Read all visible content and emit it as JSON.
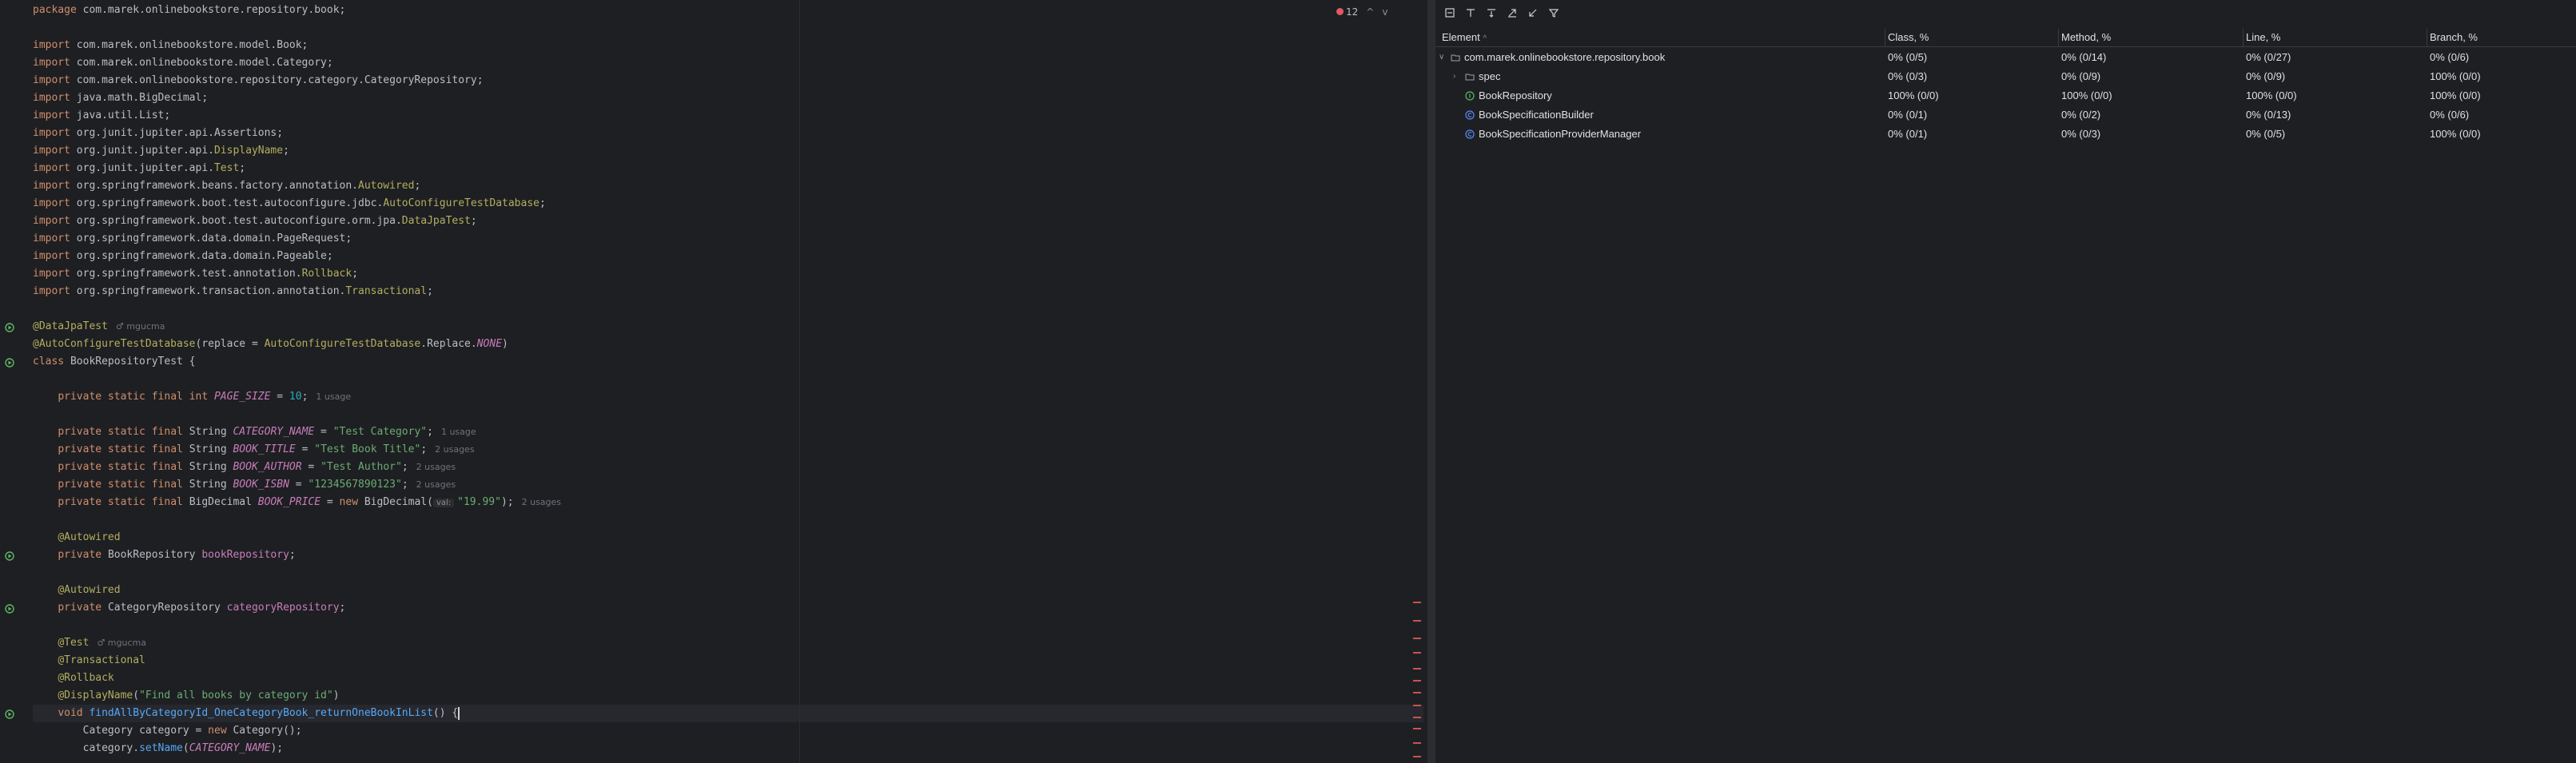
{
  "editor": {
    "lines": [
      [
        [
          "kw",
          "package "
        ],
        [
          "t",
          "com.marek.onlinebookstore.repository.book;"
        ]
      ],
      [],
      [
        [
          "kw",
          "import "
        ],
        [
          "t",
          "com.marek.onlinebookstore.model.Book;"
        ]
      ],
      [
        [
          "kw",
          "import "
        ],
        [
          "t",
          "com.marek.onlinebookstore.model.Category;"
        ]
      ],
      [
        [
          "kw",
          "import "
        ],
        [
          "t",
          "com.marek.onlinebookstore.repository.category.CategoryRepository;"
        ]
      ],
      [
        [
          "kw",
          "import "
        ],
        [
          "t",
          "java.math.BigDecimal;"
        ]
      ],
      [
        [
          "kw",
          "import "
        ],
        [
          "t",
          "java.util.List;"
        ]
      ],
      [
        [
          "kw",
          "import "
        ],
        [
          "t",
          "org.junit.jupiter.api.Assertions;"
        ]
      ],
      [
        [
          "kw",
          "import "
        ],
        [
          "t",
          "org.junit.jupiter.api."
        ],
        [
          "ann",
          "DisplayName"
        ],
        [
          "t",
          ";"
        ]
      ],
      [
        [
          "kw",
          "import "
        ],
        [
          "t",
          "org.junit.jupiter.api."
        ],
        [
          "ann",
          "Test"
        ],
        [
          "t",
          ";"
        ]
      ],
      [
        [
          "kw",
          "import "
        ],
        [
          "t",
          "org.springframework.beans.factory.annotation."
        ],
        [
          "ann",
          "Autowired"
        ],
        [
          "t",
          ";"
        ]
      ],
      [
        [
          "kw",
          "import "
        ],
        [
          "t",
          "org.springframework.boot.test.autoconfigure.jdbc."
        ],
        [
          "ann",
          "AutoConfigureTestDatabase"
        ],
        [
          "t",
          ";"
        ]
      ],
      [
        [
          "kw",
          "import "
        ],
        [
          "t",
          "org.springframework.boot.test.autoconfigure.orm.jpa."
        ],
        [
          "ann",
          "DataJpaTest"
        ],
        [
          "t",
          ";"
        ]
      ],
      [
        [
          "kw",
          "import "
        ],
        [
          "t",
          "org.springframework.data.domain.PageRequest;"
        ]
      ],
      [
        [
          "kw",
          "import "
        ],
        [
          "t",
          "org.springframework.data.domain.Pageable;"
        ]
      ],
      [
        [
          "kw",
          "import "
        ],
        [
          "t",
          "org.springframework.test.annotation."
        ],
        [
          "ann",
          "Rollback"
        ],
        [
          "t",
          ";"
        ]
      ],
      [
        [
          "kw",
          "import "
        ],
        [
          "t",
          "org.springframework.transaction.annotation."
        ],
        [
          "ann",
          "Transactional"
        ],
        [
          "t",
          ";"
        ]
      ],
      [],
      [
        [
          "ann",
          "@DataJpaTest"
        ],
        [
          "hint",
          "♂ mgucma"
        ]
      ],
      [
        [
          "ann",
          "@AutoConfigureTestDatabase"
        ],
        [
          "t",
          "(replace = "
        ],
        [
          "ann",
          "AutoConfigureTestDatabase"
        ],
        [
          "t",
          ".Replace."
        ],
        [
          "const",
          "NONE"
        ],
        [
          "t",
          ")"
        ]
      ],
      [
        [
          "kw",
          "class "
        ],
        [
          "t",
          "BookRepositoryTest {"
        ]
      ],
      [],
      [
        [
          "t",
          "    "
        ],
        [
          "kw",
          "private static final int "
        ],
        [
          "const",
          "PAGE_SIZE"
        ],
        [
          "t",
          " = "
        ],
        [
          "num",
          "10"
        ],
        [
          "t",
          ";"
        ],
        [
          "hint",
          "1 usage"
        ]
      ],
      [],
      [
        [
          "t",
          "    "
        ],
        [
          "kw",
          "private static final "
        ],
        [
          "t",
          "String "
        ],
        [
          "const",
          "CATEGORY_NAME"
        ],
        [
          "t",
          " = "
        ],
        [
          "str",
          "\"Test Category\""
        ],
        [
          "t",
          ";"
        ],
        [
          "hint",
          "1 usage"
        ]
      ],
      [
        [
          "t",
          "    "
        ],
        [
          "kw",
          "private static final "
        ],
        [
          "t",
          "String "
        ],
        [
          "const",
          "BOOK_TITLE"
        ],
        [
          "t",
          " = "
        ],
        [
          "str",
          "\"Test Book Title\""
        ],
        [
          "t",
          ";"
        ],
        [
          "hint",
          "2 usages"
        ]
      ],
      [
        [
          "t",
          "    "
        ],
        [
          "kw",
          "private static final "
        ],
        [
          "t",
          "String "
        ],
        [
          "const",
          "BOOK_AUTHOR"
        ],
        [
          "t",
          " = "
        ],
        [
          "str",
          "\"Test Author\""
        ],
        [
          "t",
          ";"
        ],
        [
          "hint",
          "2 usages"
        ]
      ],
      [
        [
          "t",
          "    "
        ],
        [
          "kw",
          "private static final "
        ],
        [
          "t",
          "String "
        ],
        [
          "const",
          "BOOK_ISBN"
        ],
        [
          "t",
          " = "
        ],
        [
          "str",
          "\"1234567890123\""
        ],
        [
          "t",
          ";"
        ],
        [
          "hint",
          "2 usages"
        ]
      ],
      [
        [
          "t",
          "    "
        ],
        [
          "kw",
          "private static final "
        ],
        [
          "t",
          "BigDecimal "
        ],
        [
          "const",
          "BOOK_PRICE"
        ],
        [
          "t",
          " = "
        ],
        [
          "kw",
          "new "
        ],
        [
          "t",
          "BigDecimal("
        ],
        [
          "param",
          "val:"
        ],
        [
          "str",
          "\"19.99\""
        ],
        [
          "t",
          ");"
        ],
        [
          "hint",
          "2 usages"
        ]
      ],
      [],
      [
        [
          "t",
          "    "
        ],
        [
          "ann",
          "@Autowired"
        ]
      ],
      [
        [
          "t",
          "    "
        ],
        [
          "kw",
          "private "
        ],
        [
          "t",
          "BookRepository "
        ],
        [
          "field",
          "bookRepository"
        ],
        [
          "t",
          ";"
        ]
      ],
      [],
      [
        [
          "t",
          "    "
        ],
        [
          "ann",
          "@Autowired"
        ]
      ],
      [
        [
          "t",
          "    "
        ],
        [
          "kw",
          "private "
        ],
        [
          "t",
          "CategoryRepository "
        ],
        [
          "field",
          "categoryRepository"
        ],
        [
          "t",
          ";"
        ]
      ],
      [],
      [
        [
          "t",
          "    "
        ],
        [
          "ann",
          "@Test"
        ],
        [
          "hint",
          "♂ mgucma"
        ]
      ],
      [
        [
          "t",
          "    "
        ],
        [
          "ann",
          "@Transactional"
        ]
      ],
      [
        [
          "t",
          "    "
        ],
        [
          "ann",
          "@Rollback"
        ]
      ],
      [
        [
          "t",
          "    "
        ],
        [
          "ann",
          "@DisplayName"
        ],
        [
          "t",
          "("
        ],
        [
          "str",
          "\"Find all books by category id\""
        ],
        [
          "t",
          ")"
        ]
      ],
      [
        [
          "t",
          "    "
        ],
        [
          "kw",
          "void "
        ],
        [
          "method",
          "findAllByCategoryId_OneCategoryBook_returnOneBookInList"
        ],
        [
          "t",
          "() {"
        ],
        [
          "caret",
          ""
        ]
      ],
      [
        [
          "t",
          "        Category "
        ],
        [
          "t",
          "category"
        ],
        [
          "t",
          " = "
        ],
        [
          "kw",
          "new "
        ],
        [
          "t",
          "Category();"
        ]
      ],
      [
        [
          "t",
          "        category."
        ],
        [
          "method",
          "setName"
        ],
        [
          "t",
          "("
        ],
        [
          "const",
          "CATEGORY_NAME"
        ],
        [
          "t",
          ");"
        ]
      ]
    ],
    "gutter_marks": [
      18,
      20,
      31,
      34,
      40
    ],
    "current_line": 40,
    "inspection": {
      "error_count": "12",
      "up_label": "^",
      "down_label": "v"
    }
  },
  "coverage": {
    "toolbar_icons": [
      "collapse-icon",
      "flatten-packages-icon",
      "navigate-icon",
      "export-icon",
      "import-icon",
      "filter-icon"
    ],
    "columns": [
      "Element",
      "Class, %",
      "Method, %",
      "Line, %",
      "Branch, %"
    ],
    "rows": [
      {
        "indent": 0,
        "expand": "open",
        "icon": "package-icon",
        "name": "com.marek.onlinebookstore.repository.book",
        "class": "0% (0/5)",
        "method": "0% (0/14)",
        "line": "0% (0/27)",
        "branch": "0% (0/6)"
      },
      {
        "indent": 1,
        "expand": "closed",
        "icon": "package-icon",
        "name": "spec",
        "class": "0% (0/3)",
        "method": "0% (0/9)",
        "line": "0% (0/9)",
        "branch": "100% (0/0)"
      },
      {
        "indent": 1,
        "expand": "none",
        "icon": "interface-icon",
        "name": "BookRepository",
        "class": "100% (0/0)",
        "method": "100% (0/0)",
        "line": "100% (0/0)",
        "branch": "100% (0/0)"
      },
      {
        "indent": 1,
        "expand": "none",
        "icon": "class-icon",
        "name": "BookSpecificationBuilder",
        "class": "0% (0/1)",
        "method": "0% (0/2)",
        "line": "0% (0/13)",
        "branch": "0% (0/6)"
      },
      {
        "indent": 1,
        "expand": "none",
        "icon": "class-icon",
        "name": "BookSpecificationProviderManager",
        "class": "0% (0/1)",
        "method": "0% (0/3)",
        "line": "0% (0/5)",
        "branch": "100% (0/0)"
      }
    ]
  }
}
